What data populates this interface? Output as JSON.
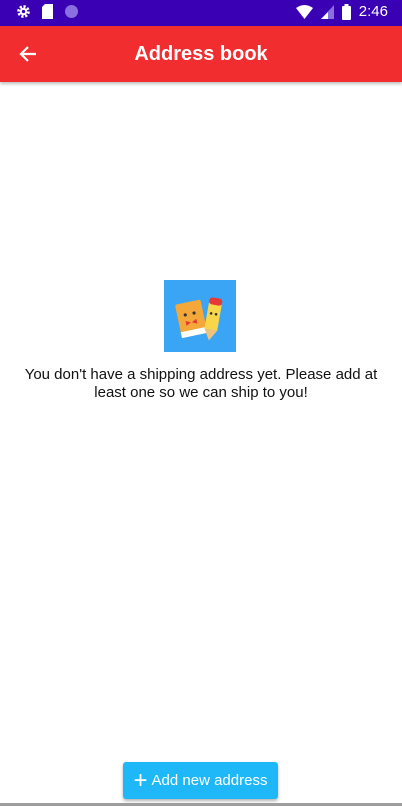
{
  "status_bar": {
    "time": "2:46",
    "icons": [
      "gear-icon",
      "sd-card-icon",
      "circle-icon",
      "wifi-icon",
      "signal-icon",
      "battery-icon"
    ]
  },
  "app_bar": {
    "title": "Address book",
    "back_icon": "arrow-left-icon"
  },
  "empty_state": {
    "message": "You don't have a shipping address yet. Please add at least one so we can ship to you!"
  },
  "add_button": {
    "label": "Add new address",
    "icon": "plus-icon"
  },
  "colors": {
    "status_bar": "#3a00b4",
    "app_bar": "#f22d2f",
    "button": "#1eb8f8",
    "illustration_bg": "#3aa5f5"
  }
}
